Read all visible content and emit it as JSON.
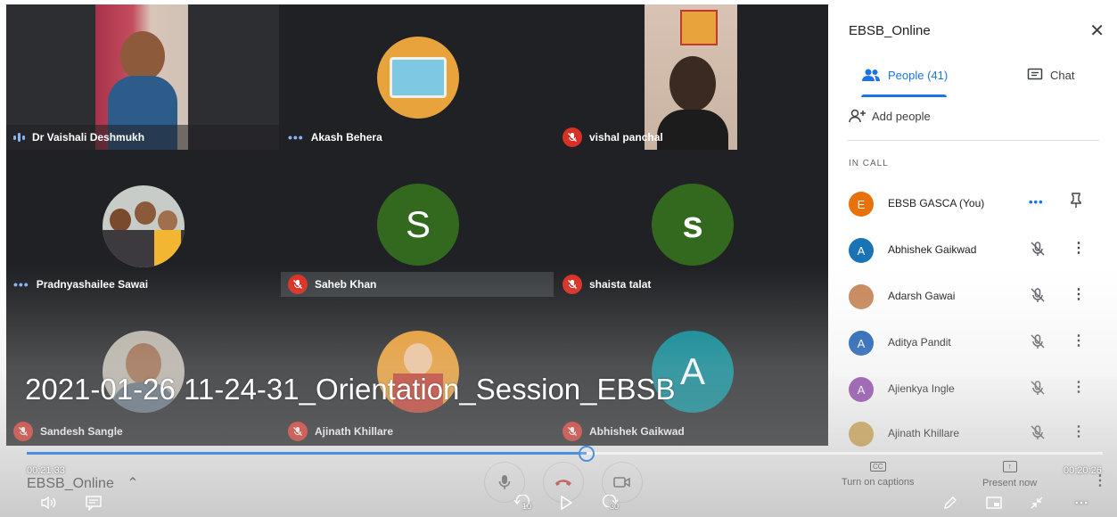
{
  "video": {
    "title": "2021-01-26 11-24-31_Orientation_Session_EBSB",
    "elapsed": "00:21:33",
    "remaining": "00:20:26",
    "progress": 0.52,
    "skip_back": "10",
    "skip_forward": "30"
  },
  "tiles": [
    {
      "name": "Dr Vaishali Deshmukh",
      "status": "speaking"
    },
    {
      "name": "Akash Behera",
      "status": "dots"
    },
    {
      "name": "vishal panchal",
      "status": "muted"
    },
    {
      "name": "Pradnyashailee Sawai",
      "status": "dots"
    },
    {
      "name": "Saheb Khan",
      "status": "muted",
      "initial": "S"
    },
    {
      "name": "shaista talat",
      "status": "muted",
      "initial": "s"
    },
    {
      "name": "Sandesh Sangle",
      "status": "muted"
    },
    {
      "name": "Ajinath Khillare",
      "status": "muted"
    },
    {
      "name": "Abhishek Gaikwad",
      "status": "muted",
      "initial": "A"
    }
  ],
  "panel": {
    "title": "EBSB_Online",
    "tab_people": "People (41)",
    "tab_chat": "Chat",
    "add_people": "Add people",
    "in_call": "IN CALL",
    "participants": [
      {
        "name": "EBSB GASCA (You)",
        "initial": "E",
        "color": "#e8710a"
      },
      {
        "name": "Abhishek Gaikwad",
        "initial": "A",
        "color": "#1a73b5"
      },
      {
        "name": "Adarsh Gawai",
        "initial": "",
        "color": "#c9875a"
      },
      {
        "name": "Aditya Pandit",
        "initial": "A",
        "color": "#1a5fb4"
      },
      {
        "name": "Ajienkya Ingle",
        "initial": "A",
        "color": "#8e44ad"
      },
      {
        "name": "Ajinath Khillare",
        "initial": "",
        "color": "#d4a64a"
      }
    ]
  },
  "bottom": {
    "meeting_name": "EBSB_Online",
    "captions": "Turn on captions",
    "present": "Present now"
  },
  "colors": {
    "accent": "#1a73e8",
    "mute_red": "#d93025",
    "green_avatar": "#33691e",
    "teal_avatar": "#00838f"
  }
}
